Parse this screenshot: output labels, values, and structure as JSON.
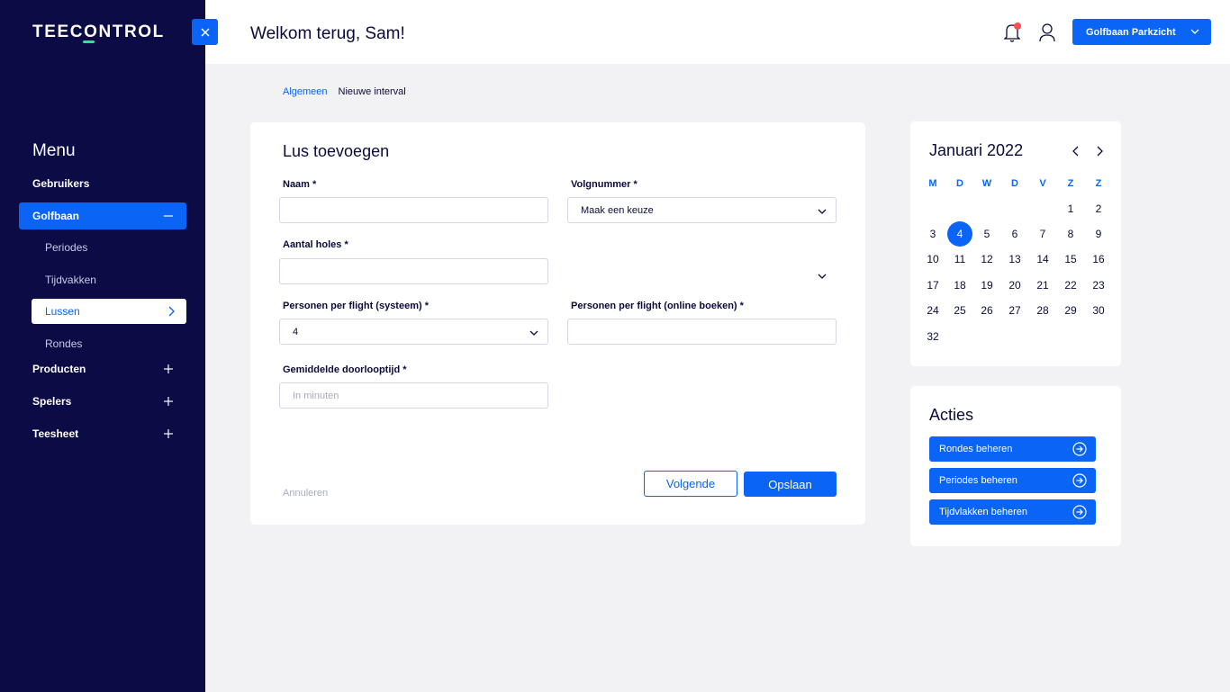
{
  "brand": {
    "logo_text": "TEECONTROL",
    "accent_color": "#0a64f5",
    "sidebar_color": "#0b0b45",
    "logo_accent": "#2ee59d"
  },
  "sidebar": {
    "menu_title": "Menu",
    "items": [
      {
        "label": "Gebruikers"
      },
      {
        "label": "Golfbaan",
        "expanded": true
      },
      {
        "label": "Producten"
      },
      {
        "label": "Spelers"
      },
      {
        "label": "Teesheet"
      }
    ],
    "subitems": [
      {
        "label": "Periodes"
      },
      {
        "label": "Tijdvakken"
      },
      {
        "label": "Lussen",
        "active": true
      },
      {
        "label": "Rondes"
      }
    ]
  },
  "header": {
    "welcome": "Welkom terug, Sam!",
    "club_select": "Golfbaan Parkzicht"
  },
  "breadcrumb": {
    "parent": "Algemeen",
    "current": "Nieuwe interval"
  },
  "form": {
    "title": "Lus toevoegen",
    "fields": {
      "naam": {
        "label": "Naam *",
        "value": ""
      },
      "volgnummer": {
        "label": "Volgnummer *",
        "value": "Maak een keuze"
      },
      "aantal_holes": {
        "label": "Aantal holes *",
        "value": ""
      },
      "personen_systeem": {
        "label": "Personen per flight (systeem) *",
        "value": "4"
      },
      "personen_online": {
        "label": "Personen per flight (online boeken) *",
        "value": ""
      },
      "doorlooptijd": {
        "label": "Gemiddelde doorlooptijd *",
        "placeholder": "In minuten"
      }
    },
    "cancel_label": "Annuleren",
    "next_label": "Volgende",
    "save_label": "Opslaan"
  },
  "calendar": {
    "title": "Januari 2022",
    "weekdays": [
      "M",
      "D",
      "W",
      "D",
      "V",
      "Z",
      "Z"
    ],
    "weeks": [
      [
        "",
        "",
        "",
        "",
        "",
        "1",
        "2"
      ],
      [
        "3",
        "4",
        "5",
        "6",
        "7",
        "8",
        "9"
      ],
      [
        "10",
        "11",
        "12",
        "13",
        "14",
        "15",
        "16"
      ],
      [
        "17",
        "18",
        "19",
        "20",
        "21",
        "22",
        "23"
      ],
      [
        "24",
        "25",
        "26",
        "27",
        "28",
        "29",
        "30"
      ],
      [
        "32",
        "",
        "",
        "",
        "",
        "",
        ""
      ]
    ],
    "selected_day": "4"
  },
  "actions": {
    "title": "Acties",
    "items": [
      {
        "label": "Rondes beheren"
      },
      {
        "label": "Periodes beheren"
      },
      {
        "label": "Tijdvlakken beheren"
      }
    ]
  }
}
